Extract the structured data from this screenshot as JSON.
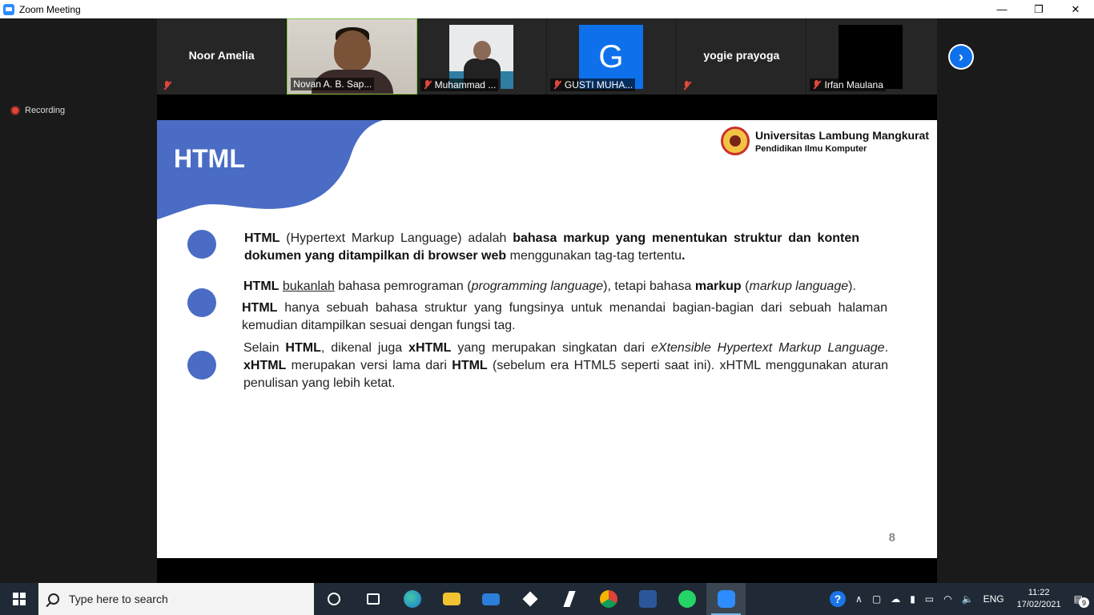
{
  "window": {
    "title": "Zoom Meeting",
    "controls": [
      "—",
      "❐",
      "✕"
    ]
  },
  "recording": {
    "label": "Recording"
  },
  "participants": [
    {
      "name": "Noor Amelia",
      "label": "",
      "muted": true,
      "video": "name"
    },
    {
      "name": "",
      "label": "Novan A. B. Sap...",
      "muted": false,
      "video": "camera"
    },
    {
      "name": "",
      "label": "Muhammad ...",
      "muted": true,
      "video": "camera"
    },
    {
      "name": "",
      "label": "GUSTI MUHA...",
      "muted": true,
      "video": "avatar",
      "avatar_letter": "G"
    },
    {
      "name": "yogie prayoga",
      "label": "",
      "muted": true,
      "video": "name"
    },
    {
      "name": "",
      "label": "Irfan Maulana",
      "muted": true,
      "video": "black"
    }
  ],
  "slide": {
    "title": "HTML",
    "university": "Universitas Lambung Mangkurat",
    "department": "Pendidikan Ilmu Komputer",
    "page_number": "8",
    "accent_color": "#4a6cc4"
  },
  "taskbar": {
    "search_placeholder": "Type here to search",
    "language": "ENG",
    "time": "11:22",
    "date": "17/02/2021",
    "notifications": "9"
  }
}
